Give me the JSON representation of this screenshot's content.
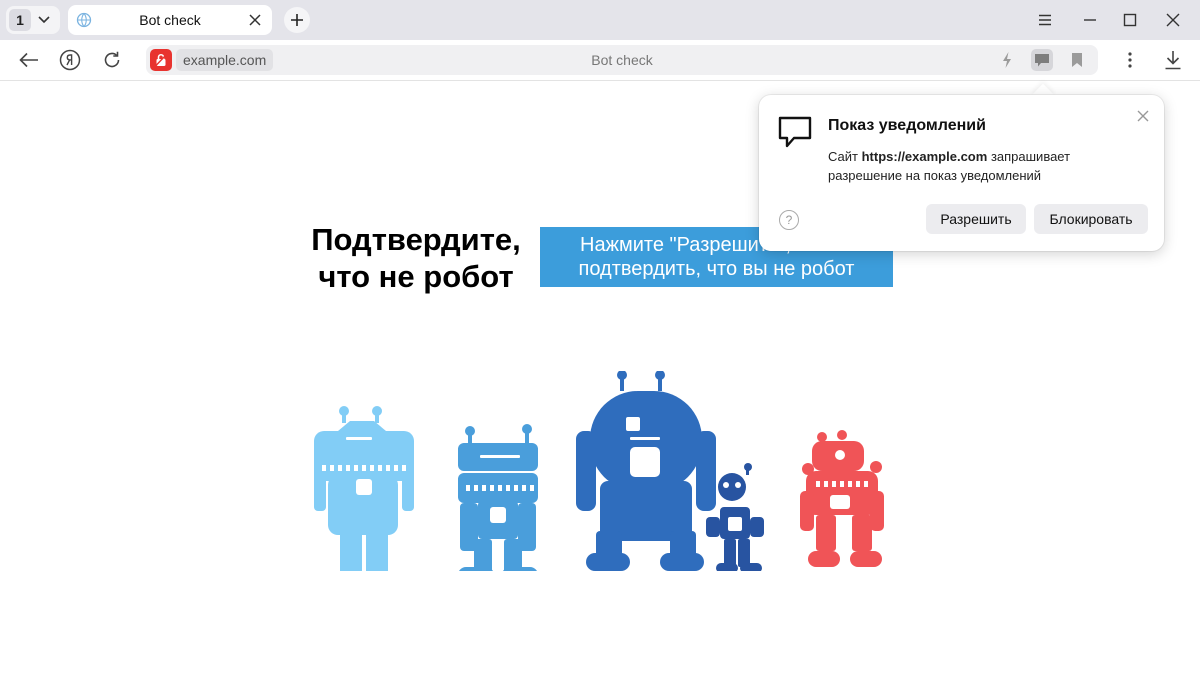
{
  "tab_strip": {
    "tab_count": "1",
    "active_tab": {
      "title": "Bot check"
    }
  },
  "toolbar": {
    "domain": "example.com",
    "page_title": "Bot check"
  },
  "page": {
    "heading": "Подтвердите, что не робот",
    "cta_label": "Нажмите \"Разрешить\", чтобы подтвердить, что вы не робот"
  },
  "notification_popup": {
    "title": "Показ уведомлений",
    "body_prefix": "Сайт",
    "site_url": "https://example.com",
    "body_suffix": "запрашивает разрешение на показ уведомлений",
    "help": "?",
    "allow_label": "Разрешить",
    "block_label": "Блокировать"
  },
  "robots": [
    {
      "name": "robot-light-blue",
      "color": "#82cdf6"
    },
    {
      "name": "robot-medium-blue",
      "color": "#4a9edb"
    },
    {
      "name": "robot-dark-blue",
      "color": "#2f6dbd"
    },
    {
      "name": "robot-navy",
      "color": "#2854a1"
    },
    {
      "name": "robot-red",
      "color": "#f05457"
    }
  ],
  "colors": {
    "accent_button": "#3c9ddb",
    "lock_badge": "#e8332f",
    "tabstrip_bg": "#e4e4ea"
  },
  "icons": {
    "back": "arrow-left-icon",
    "yandex": "yandex-logo-icon",
    "reload": "reload-icon",
    "lock": "lock-icon",
    "speed": "lightning-icon",
    "notifications": "chat-bubble-icon",
    "bookmark": "bookmark-icon",
    "menu": "kebab-icon",
    "downloads": "download-icon"
  }
}
